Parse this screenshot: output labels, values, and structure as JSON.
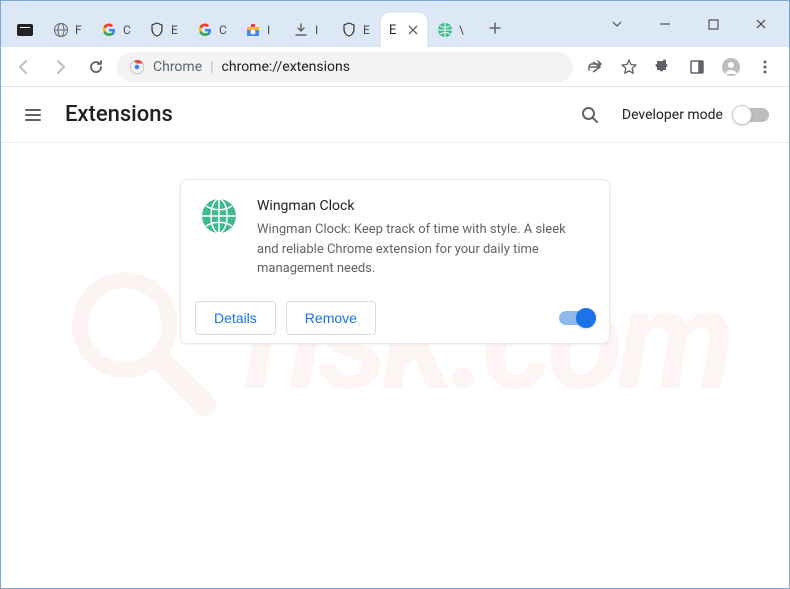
{
  "window": {
    "dropdown_icon": "chevron-down",
    "minimize": "—",
    "maximize": "▢",
    "close": "✕"
  },
  "tabs": [
    {
      "title": "",
      "favicon": "terminal"
    },
    {
      "title": "F",
      "favicon": "globe"
    },
    {
      "title": "C",
      "favicon": "google"
    },
    {
      "title": "E",
      "favicon": "shield"
    },
    {
      "title": "C",
      "favicon": "google"
    },
    {
      "title": "I",
      "favicon": "chrome-store"
    },
    {
      "title": "I",
      "favicon": "download"
    },
    {
      "title": "E",
      "favicon": "shield"
    },
    {
      "title": "E",
      "favicon": "none",
      "active": true,
      "close": true
    },
    {
      "title": "\\",
      "favicon": "green-globe"
    }
  ],
  "omnibox": {
    "scheme_icon": "chrome",
    "scheme_label": "Chrome",
    "url": "chrome://extensions"
  },
  "page": {
    "title": "Extensions",
    "dev_mode_label": "Developer mode",
    "dev_mode_on": false
  },
  "extension": {
    "name": "Wingman Clock",
    "description": "Wingman Clock: Keep track of time with style. A sleek and reliable Chrome extension for your daily time management needs.",
    "enabled": true,
    "actions": {
      "details": "Details",
      "remove": "Remove"
    }
  },
  "watermark": "risk.com"
}
